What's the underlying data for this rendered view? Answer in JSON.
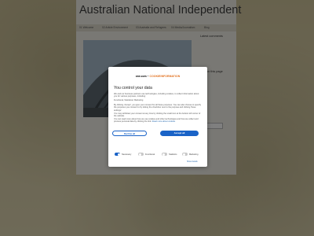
{
  "site": {
    "title": "Australian National Independent",
    "nav": [
      "01 Welcome",
      "02 Article Environment",
      "03 Australia and Refugees",
      "04 Media/Journalism",
      "Blog"
    ],
    "sidebar_title": "Latest comments",
    "sidebar_note": "on this page"
  },
  "consent": {
    "brand": "one.com",
    "brand_separator": "+",
    "partner": "COOKIEINFORMATION",
    "title": "You control your data",
    "body": "We and our business partners use technologies, including cookies, to collect information about you for various purposes, including:",
    "purposes": "Functional, Statistical, Marketing",
    "detail": "By clicking 'Accept', you give your consent for all these purposes. You can also choose to specify the purposes you consent to by ticking the checkbox next to the purpose and clicking 'Save settings'.",
    "withdraw": "You may withdraw your consent at any time by clicking the small icon at the bottom left corner of the website.",
    "more_text": "You can read more about how we use cookies and other technologies and how we collect and process personal data by clicking the link.",
    "read_more_link": "Read more about cookies",
    "decline_label": "Decline all",
    "accept_label": "Accept all",
    "toggles": [
      {
        "label": "Necessary",
        "on": true
      },
      {
        "label": "Functional",
        "on": false
      },
      {
        "label": "Statistics",
        "on": false
      },
      {
        "label": "Marketing",
        "on": false
      }
    ],
    "show_details": "Show details"
  }
}
